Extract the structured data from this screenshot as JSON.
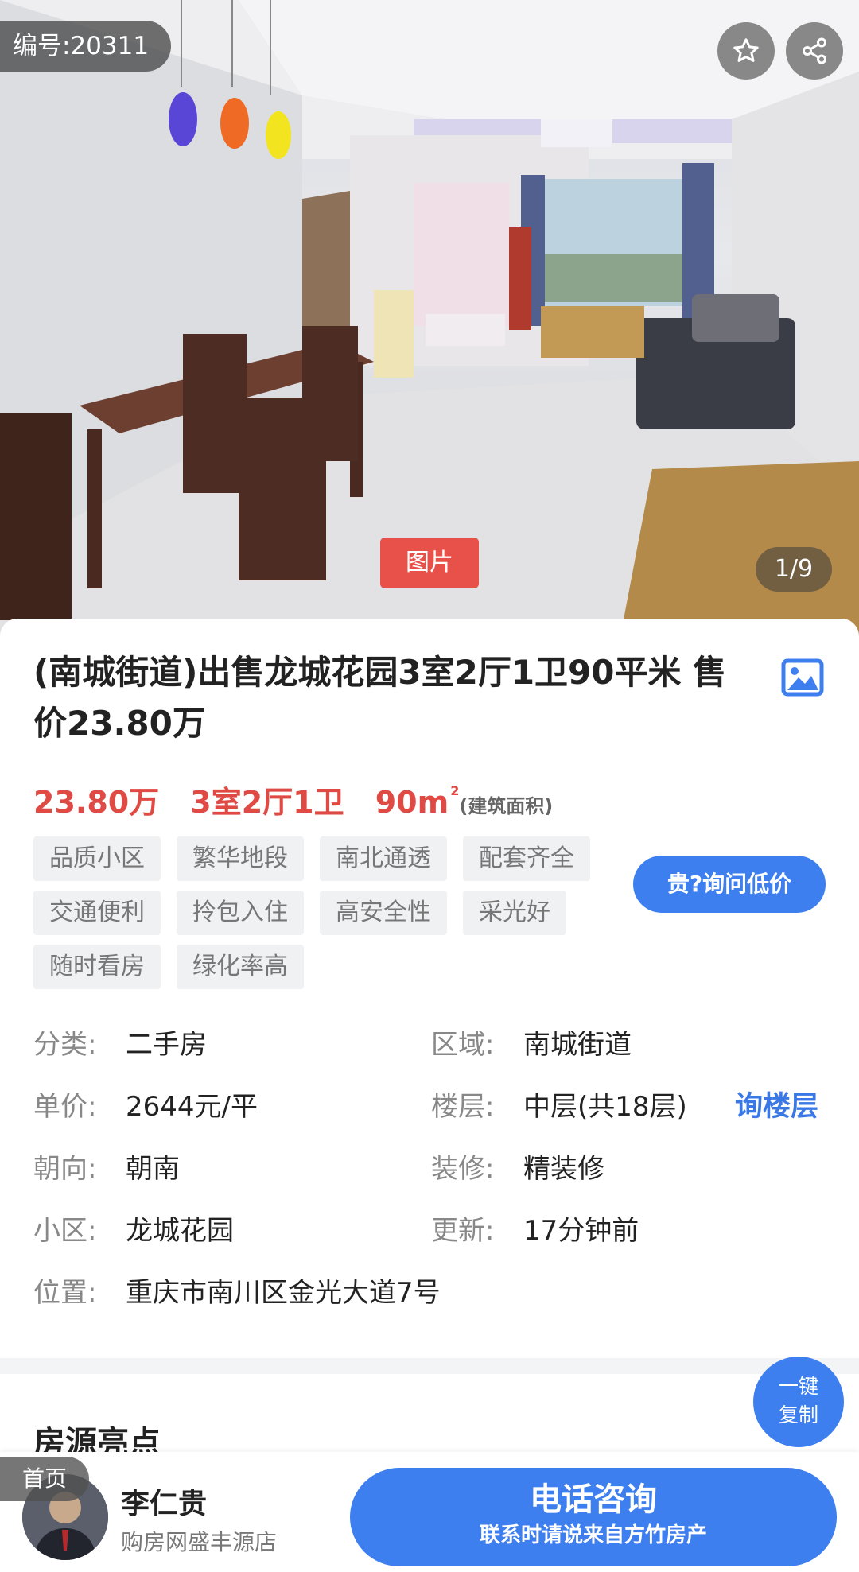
{
  "photo": {
    "ref_number": "编号:20311",
    "tag": "图片",
    "counter": "1/9",
    "icons": [
      "star-icon",
      "share-icon"
    ]
  },
  "listing": {
    "title": "(南城街道)出售龙城花园3室2厅1卫90平米 售价23.80万",
    "price": "23.80万",
    "layout": "3室2厅1卫",
    "area": "90m",
    "area_sup": "2",
    "area_note": "(建筑面积)",
    "tags": [
      "品质小区",
      "繁华地段",
      "南北通透",
      "配套齐全",
      "交通便利",
      "拎包入住",
      "高安全性",
      "采光好",
      "随时看房",
      "绿化率高"
    ],
    "ask_price_button": "贵?询问低价"
  },
  "details": {
    "category_label": "分类:",
    "category_value": "二手房",
    "region_label": "区域:",
    "region_value": "南城街道",
    "unit_price_label": "单价:",
    "unit_price_value": "2644元/平",
    "floor_label": "楼层:",
    "floor_value": "中层(共18层)",
    "floor_link": "询楼层",
    "orientation_label": "朝向:",
    "orientation_value": "朝南",
    "decoration_label": "装修:",
    "decoration_value": "精装修",
    "community_label": "小区:",
    "community_value": "龙城花园",
    "updated_label": "更新:",
    "updated_value": "17分钟前",
    "location_label": "位置:",
    "location_value": "重庆市南川区金光大道7号"
  },
  "highlights": {
    "title": "房源亮点",
    "copy_line1": "一键",
    "copy_line2": "复制"
  },
  "bottom": {
    "home_tab": "首页",
    "agent_name": "李仁贵",
    "agent_shop": "购房网盛丰源店",
    "call_main": "电话咨询",
    "call_sub": "联系时请说来自方竹房产"
  },
  "colors": {
    "accent_blue": "#3e7ff0",
    "price_red": "#e04a45",
    "photo_tag_red": "#e8504a"
  }
}
